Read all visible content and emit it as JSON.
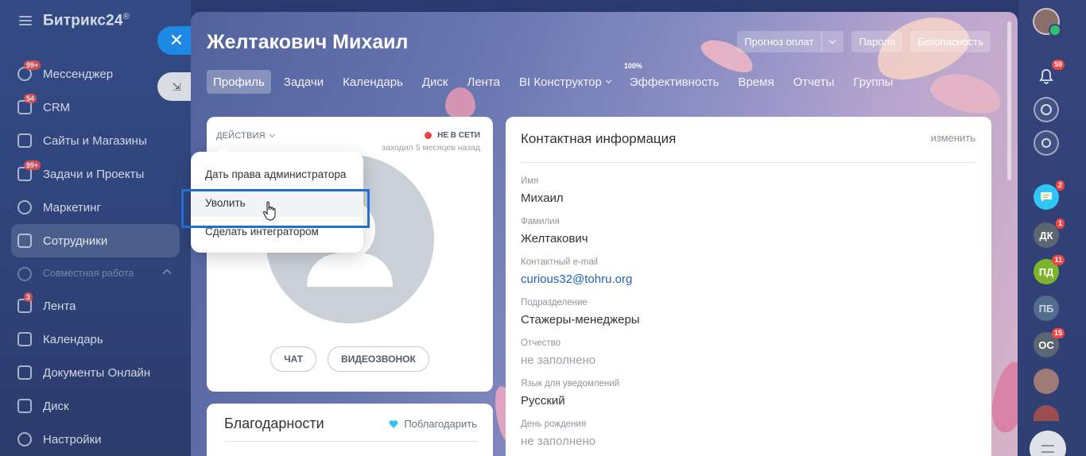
{
  "sidebar": {
    "brand": "Битрикс24",
    "brand_mark": "®",
    "items": [
      {
        "label": "Мессенджер",
        "badge": "99+"
      },
      {
        "label": "CRM",
        "badge": "54"
      },
      {
        "label": "Сайты и Магазины",
        "badge": ""
      },
      {
        "label": "Задачи и Проекты",
        "badge": "99+"
      },
      {
        "label": "Маркетинг",
        "badge": ""
      },
      {
        "label": "Сотрудники",
        "badge": ""
      },
      {
        "label": "Совместная работа",
        "badge": ""
      },
      {
        "label": "Лента",
        "badge": "3"
      },
      {
        "label": "Календарь",
        "badge": ""
      },
      {
        "label": "Документы Онлайн",
        "badge": ""
      },
      {
        "label": "Диск",
        "badge": ""
      },
      {
        "label": "Настройки",
        "badge": ""
      }
    ]
  },
  "slider": {
    "close_glyph": "✕",
    "collapse_glyph": "⇲",
    "title": "Желтакович Михаил",
    "top_actions": {
      "payment_forecast": "Прогноз оплат",
      "passwords": "Пароли",
      "security": "Безопасность"
    },
    "tabs": [
      {
        "label": "Профиль"
      },
      {
        "label": "Задачи"
      },
      {
        "label": "Календарь"
      },
      {
        "label": "Диск"
      },
      {
        "label": "Лента"
      },
      {
        "label": "BI Конструктор"
      },
      {
        "label": "Эффективность",
        "counter": "100%"
      },
      {
        "label": "Время"
      },
      {
        "label": "Отчеты"
      },
      {
        "label": "Группы"
      }
    ]
  },
  "profile": {
    "actions_label": "ДЕЙСТВИЯ",
    "status": "НЕ В СЕТИ",
    "last_seen": "заходил 5 месяцев назад",
    "chat_button": "ЧАТ",
    "video_button": "ВИДЕОЗВОНОК",
    "menu": [
      "Дать права администратора",
      "Уволить",
      "Сделать интегратором"
    ]
  },
  "thanks": {
    "title": "Благодарности",
    "action": "Поблагодарить"
  },
  "contact": {
    "title": "Контактная информация",
    "edit": "изменить",
    "fields": [
      {
        "label": "Имя",
        "value": "Михаил"
      },
      {
        "label": "Фамилия",
        "value": "Желтакович"
      },
      {
        "label": "Контактный e-mail",
        "value": "curious32@tohru.org"
      },
      {
        "label": "Подразделение",
        "value": "Стажеры-менеджеры"
      },
      {
        "label": "Отчество",
        "value": "не заполнено"
      },
      {
        "label": "Язык для уведомлений",
        "value": "Русский"
      },
      {
        "label": "День рождения",
        "value": "не заполнено"
      }
    ]
  },
  "right_bar": {
    "notifications_badge": "59",
    "chat_badge": "2",
    "contacts": [
      {
        "initials": "ДК",
        "badge": "1",
        "color": "#5c6672"
      },
      {
        "initials": "ПД",
        "badge": "11",
        "color": "#7bb52c"
      },
      {
        "initials": "ПБ",
        "badge": "",
        "color": "#6a8a9c"
      },
      {
        "initials": "ОС",
        "badge": "15",
        "color": "#5c6672"
      }
    ]
  },
  "colors": {
    "accent": "#1e88e5",
    "link": "#1f62b5",
    "offline": "#ef3f3f",
    "highlight": "#1f6fd4"
  }
}
